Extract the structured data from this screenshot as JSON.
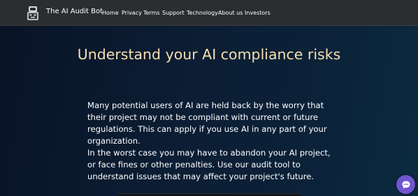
{
  "navbar": {
    "brand": "The AI Audit Bot",
    "links": [
      "Home",
      "Privacy",
      "Terms",
      "Support",
      "Technology",
      "About us",
      "Investors"
    ]
  },
  "hero": {
    "title": "Understand your AI compliance risks",
    "paragraph1": "Many potential users of AI are held back by the worry that their project may not be compliant with current or future regulations. This can apply if you use AI in any part of your organization.",
    "paragraph2": "In the worst case you may have to abandon your AI project, or face fines or other penalties. Use our audit tool to understand issues that may affect your project's future."
  },
  "colors": {
    "accent_title": "#f6deb0",
    "chat_button": "#6f56cf",
    "navbar_bg": "#2b2d2f"
  },
  "icons": {
    "logo": "robot-logo-icon",
    "chat": "chat-bubble-icon"
  }
}
